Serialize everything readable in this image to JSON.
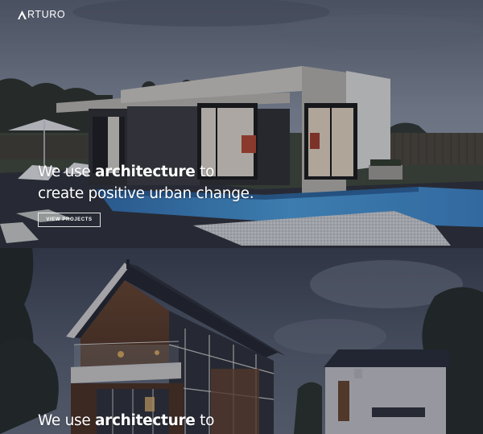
{
  "brand": {
    "logo_letter": "A",
    "logo_text": "RTURO"
  },
  "hero": {
    "headline_pre": "We use ",
    "headline_strong": "architecture",
    "headline_post": " to",
    "headline_line2": "create positive urban change.",
    "button_label": "VIEW PROJECTS"
  },
  "hero2": {
    "headline_pre": "We use ",
    "headline_strong": "architecture",
    "headline_post": " to"
  },
  "colors": {
    "text": "#ffffff",
    "pool": "#3b82c6",
    "sky": "#7b8597",
    "overlay": "#1c2030"
  }
}
